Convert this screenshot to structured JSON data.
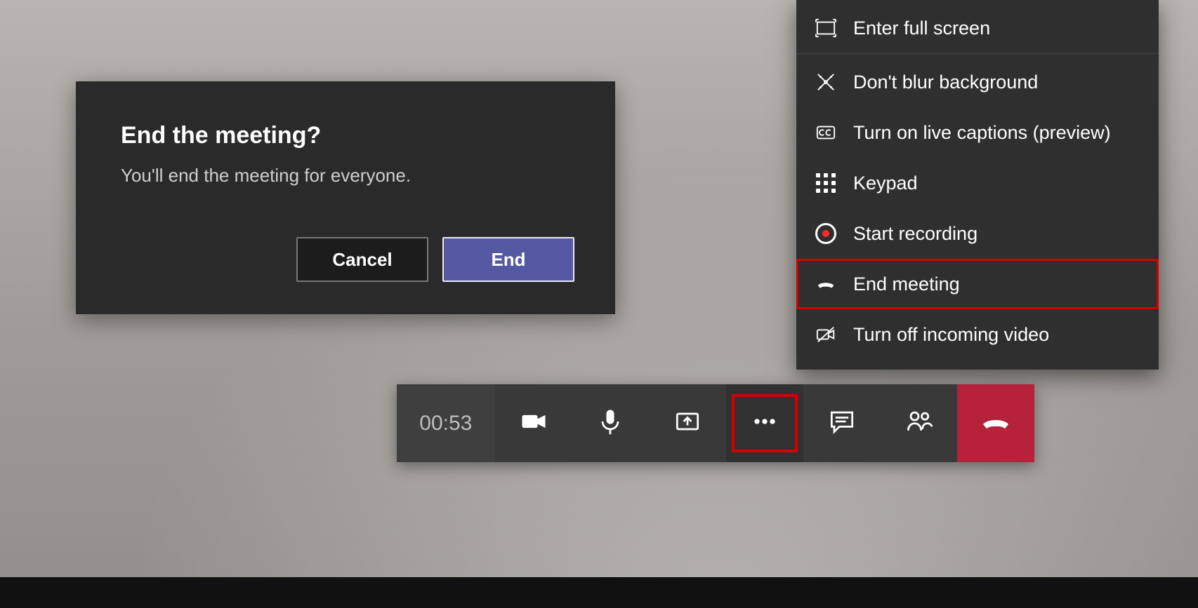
{
  "dialog": {
    "title": "End the meeting?",
    "message": "You'll end the meeting for everyone.",
    "cancel_label": "Cancel",
    "end_label": "End"
  },
  "menu": {
    "items": [
      {
        "icon": "fullscreen-icon",
        "label": "Enter full screen",
        "sep_after": true
      },
      {
        "icon": "blur-icon",
        "label": "Don't blur background"
      },
      {
        "icon": "captions-icon",
        "label": "Turn on live captions (preview)"
      },
      {
        "icon": "keypad-icon",
        "label": "Keypad"
      },
      {
        "icon": "record-icon",
        "label": "Start recording"
      },
      {
        "icon": "hangup-icon",
        "label": "End meeting",
        "highlighted": true
      },
      {
        "icon": "video-off-icon",
        "label": "Turn off incoming video"
      }
    ]
  },
  "callbar": {
    "duration": "00:53",
    "buttons": [
      {
        "name": "camera-button",
        "icon": "camera-icon"
      },
      {
        "name": "mic-button",
        "icon": "mic-icon"
      },
      {
        "name": "share-button",
        "icon": "share-screen-icon"
      },
      {
        "name": "more-button",
        "icon": "more-icon",
        "highlighted": true
      },
      {
        "name": "chat-button",
        "icon": "chat-icon"
      },
      {
        "name": "people-button",
        "icon": "people-icon"
      }
    ],
    "hangup_name": "hangup-button"
  },
  "colors": {
    "accent": "#5558a3",
    "danger": "#b5223a",
    "highlight": "#d40000",
    "panel": "#2a2a2a"
  }
}
